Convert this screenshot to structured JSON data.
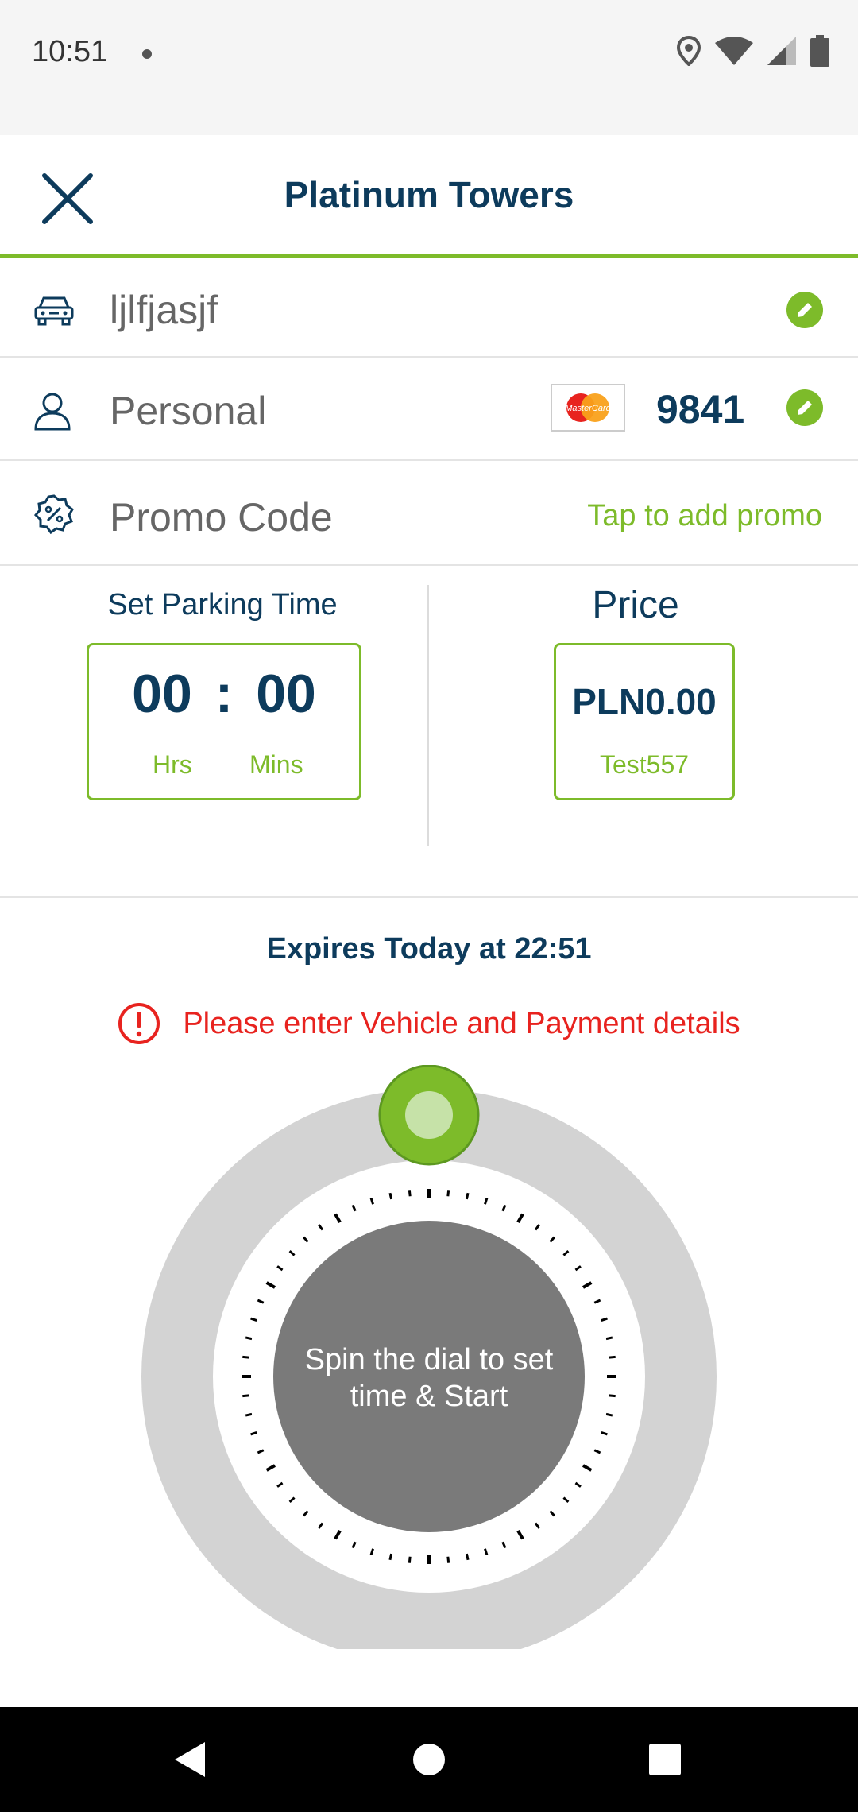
{
  "status_bar": {
    "time": "10:51"
  },
  "header": {
    "title": "Platinum Towers"
  },
  "vehicle": {
    "name": "ljlfjasjf"
  },
  "payment": {
    "label": "Personal",
    "card_brand": "MasterCard",
    "card_last4": "9841"
  },
  "promo": {
    "label": "Promo Code",
    "action": "Tap to add promo"
  },
  "parking_time": {
    "heading": "Set Parking Time",
    "hours": "00",
    "separator": ":",
    "minutes": "00",
    "hours_label": "Hrs",
    "minutes_label": "Mins"
  },
  "price": {
    "heading": "Price",
    "amount": "PLN0.00",
    "rate_name": "Test557"
  },
  "expiry": {
    "text": "Expires Today at 22:51"
  },
  "warning": {
    "text": "Please enter Vehicle and Payment details"
  },
  "dial": {
    "line1": "Spin the dial to set",
    "line2": "time & Start"
  },
  "colors": {
    "brand_green": "#7dbb2a",
    "navy": "#0d3b5c",
    "error_red": "#e8231f"
  }
}
